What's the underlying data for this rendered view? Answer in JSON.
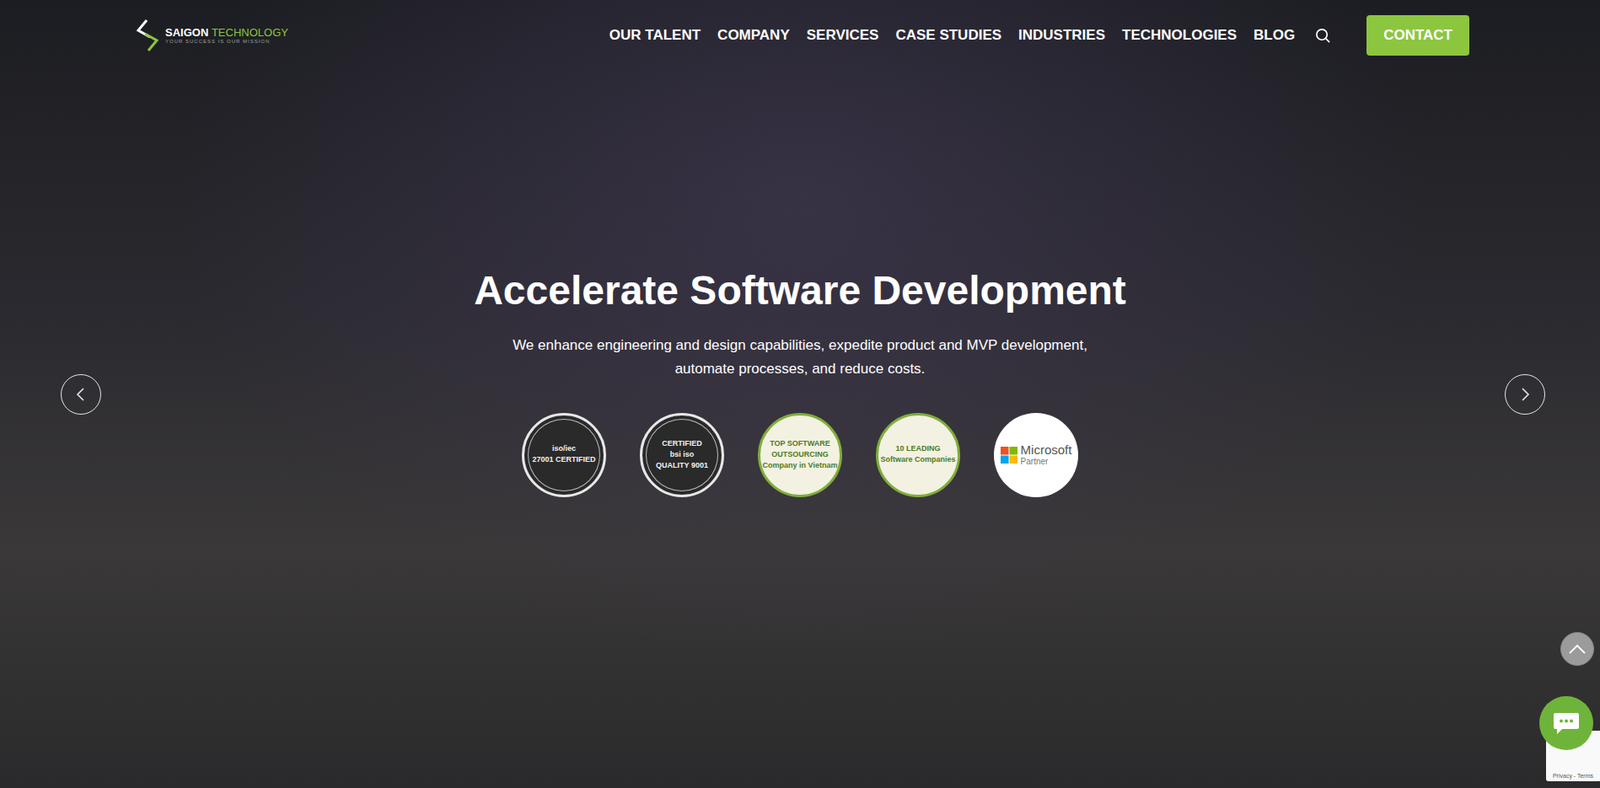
{
  "logo": {
    "name": "SAIGON",
    "accent": "TECHNOLOGY",
    "tagline": "YOUR SUCCESS IS OUR MISSION"
  },
  "nav": {
    "items": [
      {
        "label": "OUR TALENT"
      },
      {
        "label": "COMPANY"
      },
      {
        "label": "SERVICES"
      },
      {
        "label": "CASE STUDIES"
      },
      {
        "label": "INDUSTRIES"
      },
      {
        "label": "TECHNOLOGIES"
      },
      {
        "label": "BLOG"
      }
    ],
    "contact": "CONTACT"
  },
  "hero": {
    "title": "Accelerate Software Development",
    "subtitle": "We enhance engineering and design capabilities, expedite product and MVP development, automate processes, and reduce costs."
  },
  "badges": [
    {
      "kind": "dark",
      "lines": [
        "iso/iec",
        "27001 CERTIFIED"
      ]
    },
    {
      "kind": "dark",
      "lines": [
        "CERTIFIED",
        "bsi iso",
        "QUALITY 9001"
      ]
    },
    {
      "kind": "green",
      "lines": [
        "TOP SOFTWARE",
        "OUTSOURCING",
        "Company in Vietnam"
      ]
    },
    {
      "kind": "green",
      "lines": [
        "10 LEADING",
        "Software Companies"
      ]
    },
    {
      "kind": "partner",
      "lines": [
        "Microsoft",
        "Partner"
      ]
    }
  ],
  "recaptcha": {
    "text": "Privacy - Terms"
  }
}
